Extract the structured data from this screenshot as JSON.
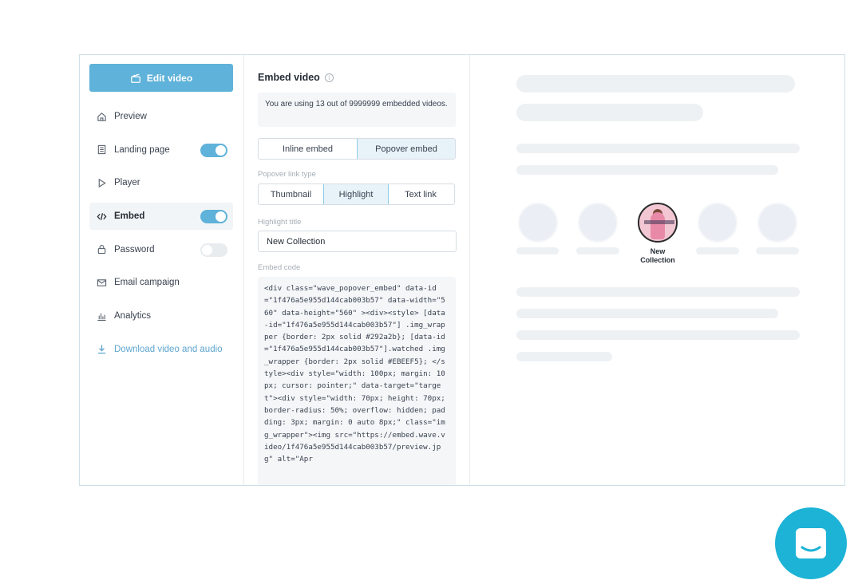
{
  "sidebar": {
    "edit_button": "Edit video",
    "items": [
      {
        "label": "Preview",
        "icon": "home-icon"
      },
      {
        "label": "Landing page",
        "icon": "page-icon",
        "toggle": true
      },
      {
        "label": "Player",
        "icon": "play-icon"
      },
      {
        "label": "Embed",
        "icon": "code-icon",
        "toggle": true
      },
      {
        "label": "Password",
        "icon": "lock-icon",
        "toggle": false
      },
      {
        "label": "Email campaign",
        "icon": "mail-icon"
      },
      {
        "label": "Analytics",
        "icon": "analytics-icon"
      },
      {
        "label": "Download video and audio",
        "icon": "download-icon"
      }
    ]
  },
  "embed": {
    "title": "Embed video",
    "usage_text": "You are using 13 out of 9999999 embedded videos.",
    "mode_tabs": [
      "Inline embed",
      "Popover embed"
    ],
    "mode_selected": "Popover embed",
    "popover_type_label": "Popover link type",
    "popover_types": [
      "Thumbnail",
      "Highlight",
      "Text link"
    ],
    "popover_type_selected": "Highlight",
    "highlight_title_label": "Highlight title",
    "highlight_title_value": "New Collection",
    "embed_code_label": "Embed code",
    "embed_code": "<div class=\"wave_popover_embed\" data-id=\"1f476a5e955d144cab003b57\" data-width=\"560\" data-height=\"560\" ><div><style> [data-id=\"1f476a5e955d144cab003b57\"] .img_wrapper {border: 2px solid #292a2b}; [data-id=\"1f476a5e955d144cab003b57\"].watched .img_wrapper {border: 2px solid #EBEEF5}; </style><div style=\"width: 100px; margin: 10px; cursor: pointer;\" data-target=\"target\"><div style=\"width: 70px; height: 70px; border-radius: 50%; overflow: hidden; padding: 3px; margin: 0 auto 8px;\" class=\"img_wrapper\"><img src=\"https://embed.wave.video/1f476a5e955d144cab003b57/preview.jpg\" alt=\"Apr"
  },
  "preview": {
    "highlight_caption": "New Collection"
  },
  "colors": {
    "accent": "#5fb2d9",
    "chat_button": "#1cb3d6",
    "highlight_border": "#292a2b"
  },
  "chat_launcher_icon": "chat-icon"
}
